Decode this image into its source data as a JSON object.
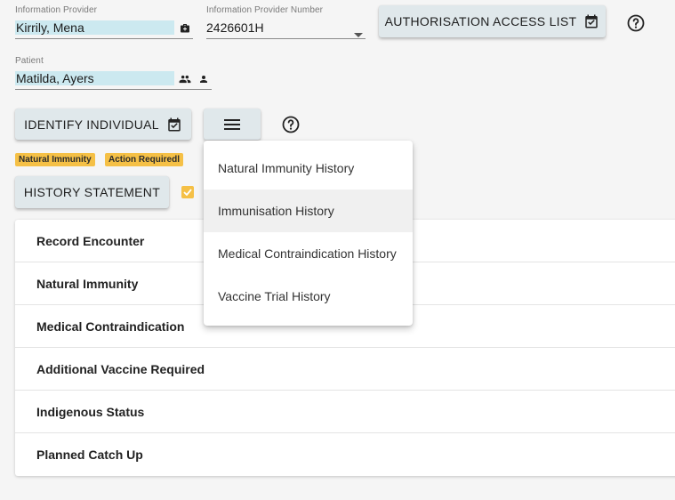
{
  "provider": {
    "label": "Information Provider",
    "value": "Kirrily, Mena",
    "icon": "medical-bag-icon"
  },
  "provider_number": {
    "label": "Information Provider Number",
    "value": "2426601H",
    "icon": "dropdown-arrow-icon"
  },
  "auth_button": {
    "label": "AUTHORISATION ACCESS LIST",
    "icon": "calendar-check-icon"
  },
  "patient": {
    "label": "Patient",
    "value": "Matilda, Ayers",
    "icons": [
      "people-icon",
      "person-icon"
    ]
  },
  "identify_button": {
    "label": "IDENTIFY INDIVIDUAL",
    "icon": "calendar-check-icon"
  },
  "menu_button": {
    "icon": "hamburger-menu-icon"
  },
  "badges": [
    "Natural Immunity",
    "Action Requiredl"
  ],
  "history_button": {
    "label": "HISTORY STATEMENT"
  },
  "sections": [
    "Record Encounter",
    "Natural Immunity",
    "Medical Contraindication",
    "Additional Vaccine Required",
    "Indigenous Status",
    "Planned Catch Up"
  ],
  "dropdown_menu": {
    "items": [
      "Natural Immunity History",
      "Immunisation History",
      "Medical Contraindication History",
      "Vaccine Trial History"
    ],
    "highlighted": "Immunisation History"
  },
  "colors": {
    "background": "#f5f5f5",
    "button": "#e0e8eb",
    "badge": "#f5c046",
    "field_highlight": "#cce9f0"
  }
}
